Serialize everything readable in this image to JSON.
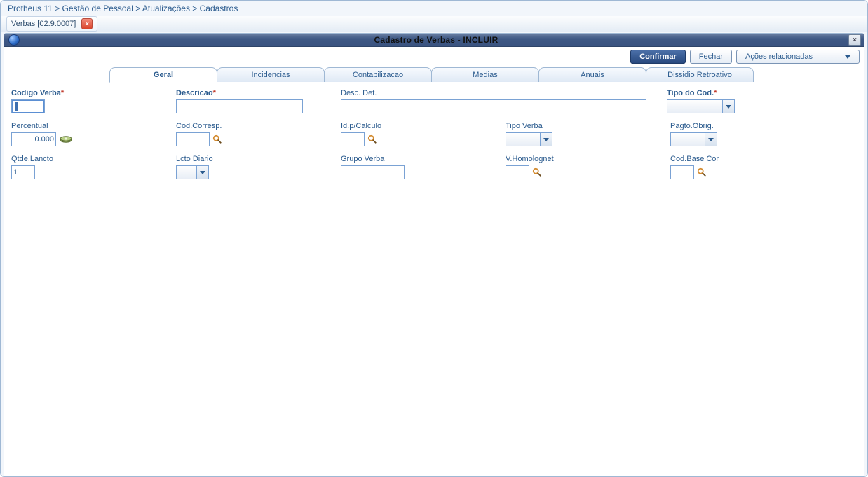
{
  "breadcrumb": "Protheus 11 > Gestão de Pessoal > Atualizações > Cadastros",
  "window_tab": {
    "label": "Verbas [02.9.0007]"
  },
  "titlebar": "Cadastro de Verbas - INCLUIR",
  "toolbar": {
    "confirm": "Confirmar",
    "close": "Fechar",
    "related_actions": "Ações relacionadas"
  },
  "tabs": [
    "Geral",
    "Incidencias",
    "Contabilizacao",
    "Medias",
    "Anuais",
    "Dissidio Retroativo"
  ],
  "active_tab_index": 0,
  "fields": {
    "codigo_verba": {
      "label": "Codigo Verba",
      "required": true,
      "value": ""
    },
    "descricao": {
      "label": "Descricao",
      "required": true,
      "value": ""
    },
    "desc_det": {
      "label": "Desc. Det.",
      "value": ""
    },
    "tipo_do_cod": {
      "label": "Tipo do Cod.",
      "required": true,
      "value": ""
    },
    "percentual": {
      "label": "Percentual",
      "value": "0.000"
    },
    "cod_corresp": {
      "label": "Cod.Corresp.",
      "value": ""
    },
    "id_p_calculo": {
      "label": "Id.p/Calculo",
      "value": ""
    },
    "tipo_verba": {
      "label": "Tipo Verba",
      "value": ""
    },
    "pagto_obrig": {
      "label": "Pagto.Obrig.",
      "value": ""
    },
    "qtde_lancto": {
      "label": "Qtde.Lancto",
      "value": "1"
    },
    "lcto_diario": {
      "label": "Lcto Diario",
      "value": ""
    },
    "grupo_verba": {
      "label": "Grupo Verba",
      "value": ""
    },
    "v_homolognet": {
      "label": "V.Homolognet",
      "value": ""
    },
    "cod_base_cor": {
      "label": "Cod.Base Cor",
      "value": ""
    }
  }
}
